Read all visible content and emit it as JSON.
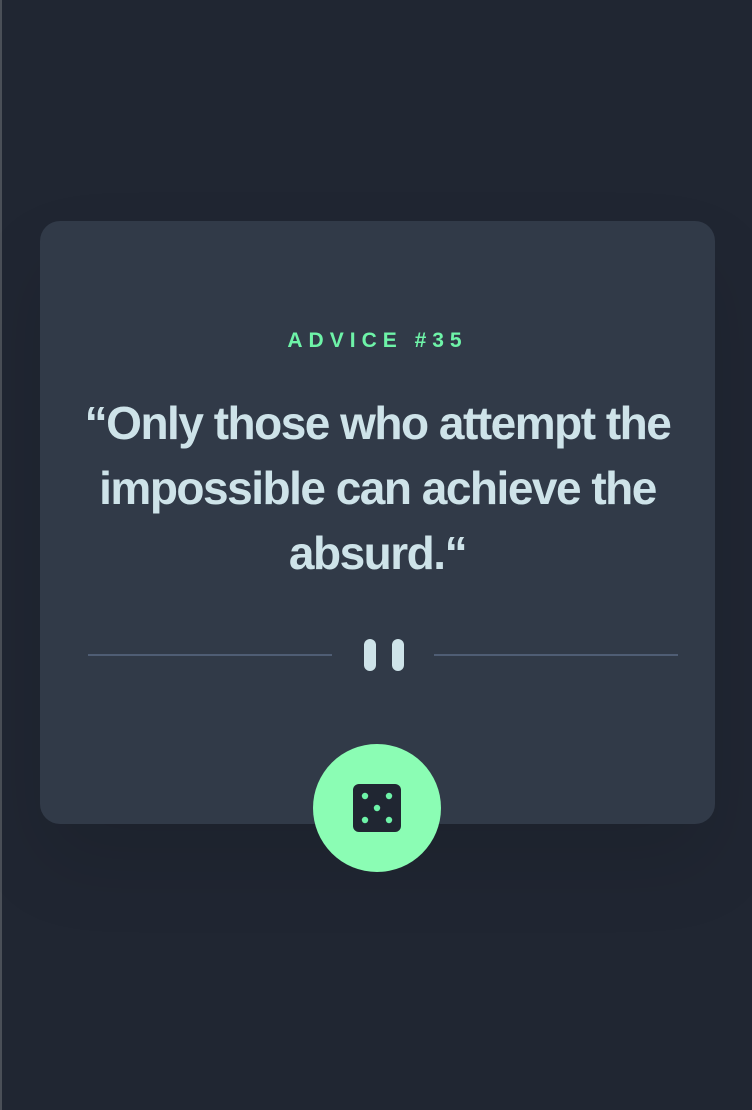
{
  "advice": {
    "heading": "ADVICE #35",
    "quote": "“Only those who attempt the impossible can achieve the absurd.“"
  },
  "icons": {
    "divider": "pause-icon",
    "button": "dice-icon"
  },
  "colors": {
    "background": "#202632",
    "card": "#313a48",
    "accent": "#6ef3a8",
    "button": "#8bfdb4",
    "text": "#cee3e9",
    "divider": "#4f5d74"
  }
}
